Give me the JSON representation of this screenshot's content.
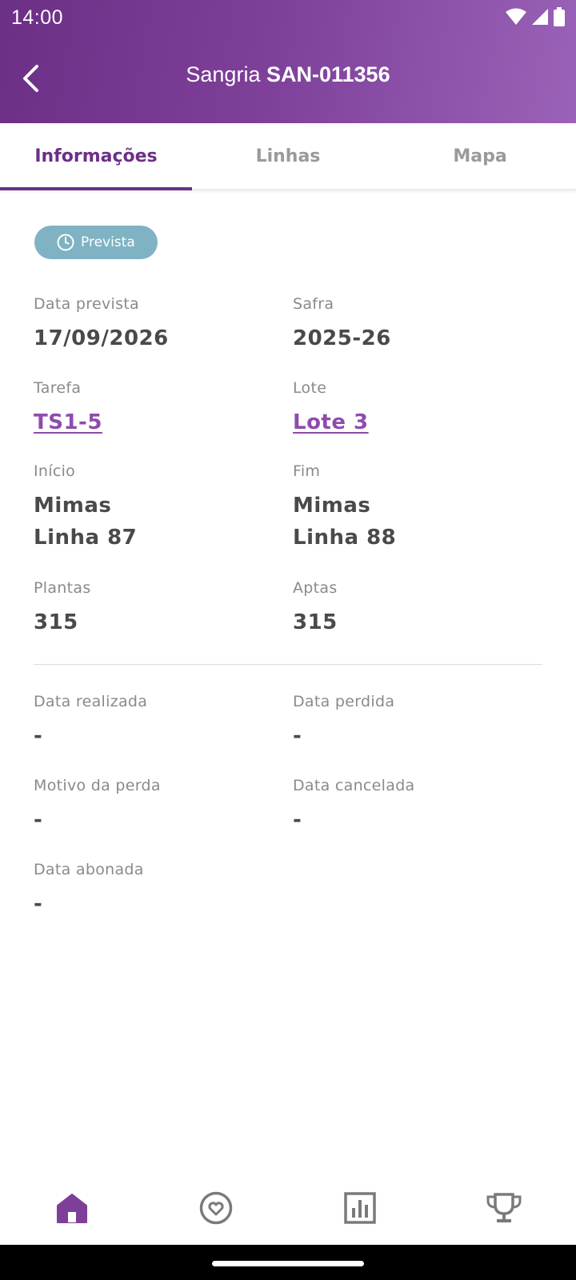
{
  "status_bar": {
    "time": "14:00"
  },
  "header": {
    "title_prefix": "Sangria",
    "title_code": "SAN-011356"
  },
  "tabs": [
    {
      "label": "Informações",
      "active": true
    },
    {
      "label": "Linhas",
      "active": false
    },
    {
      "label": "Mapa",
      "active": false
    }
  ],
  "status_badge": {
    "label": "Prevista",
    "icon": "clock-icon",
    "color": "#7fb3c3"
  },
  "fields": {
    "data_prevista": {
      "label": "Data prevista",
      "value": "17/09/2026"
    },
    "safra": {
      "label": "Safra",
      "value": "2025-26"
    },
    "tarefa": {
      "label": "Tarefa",
      "value": "TS1-5"
    },
    "lote": {
      "label": "Lote",
      "value": "Lote 3"
    },
    "inicio": {
      "label": "Início",
      "value_line1": "Mimas",
      "value_line2": "Linha 87"
    },
    "fim": {
      "label": "Fim",
      "value_line1": "Mimas",
      "value_line2": "Linha 88"
    },
    "plantas": {
      "label": "Plantas",
      "value": "315"
    },
    "aptas": {
      "label": "Aptas",
      "value": "315"
    },
    "data_realizada": {
      "label": "Data realizada",
      "value": "-"
    },
    "data_perdida": {
      "label": "Data perdida",
      "value": "-"
    },
    "motivo_perda": {
      "label": "Motivo da perda",
      "value": "-"
    },
    "data_cancelada": {
      "label": "Data cancelada",
      "value": "-"
    },
    "data_abonada": {
      "label": "Data abonada",
      "value": "-"
    }
  },
  "bottom_nav": [
    {
      "icon": "home-icon",
      "active": true
    },
    {
      "icon": "drop-icon",
      "active": false
    },
    {
      "icon": "chart-icon",
      "active": false
    },
    {
      "icon": "trophy-icon",
      "active": false
    }
  ],
  "colors": {
    "primary": "#6c2f86",
    "link": "#8f4bad",
    "badge": "#7fb3c3"
  }
}
